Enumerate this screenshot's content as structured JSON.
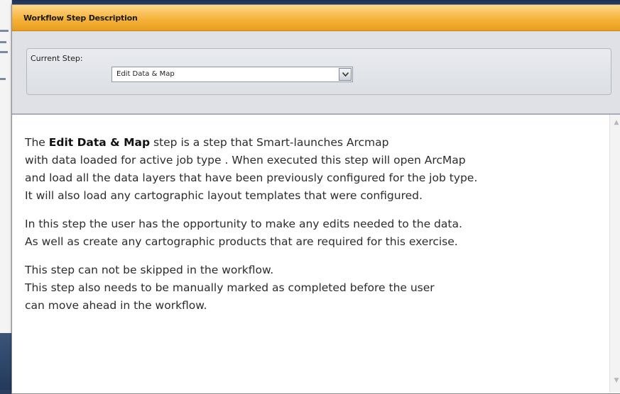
{
  "window": {
    "title": "Workflow Step Description"
  },
  "current_step": {
    "label": "Current Step:",
    "selected_value": "Edit Data & Map"
  },
  "description": {
    "paragraph1": {
      "prefix": "The ",
      "bold": "Edit Data & Map",
      "lines": [
        " step is a step that Smart-launches Arcmap",
        "with data loaded for active job type . When executed this step will open ArcMap",
        "and load all the data layers that have been previously configured for the job type.",
        "It will also load any cartographic layout templates that were configured."
      ]
    },
    "paragraph2": [
      "In this step the user has the opportunity to make any edits needed to the data.",
      "As well as create any cartographic products that are required for this exercise."
    ],
    "paragraph3": [
      "This step can not be skipped in the workflow.",
      "This step also needs to be manually marked as completed before the user",
      "can move ahead in the workflow."
    ]
  },
  "icons": {
    "dropdown": "chevron-down-icon",
    "scroll_up": "arrow-up-icon",
    "scroll_down": "arrow-down-icon"
  },
  "colors": {
    "titlebar": "#f6b33b",
    "panel": "#dfe1e6"
  }
}
